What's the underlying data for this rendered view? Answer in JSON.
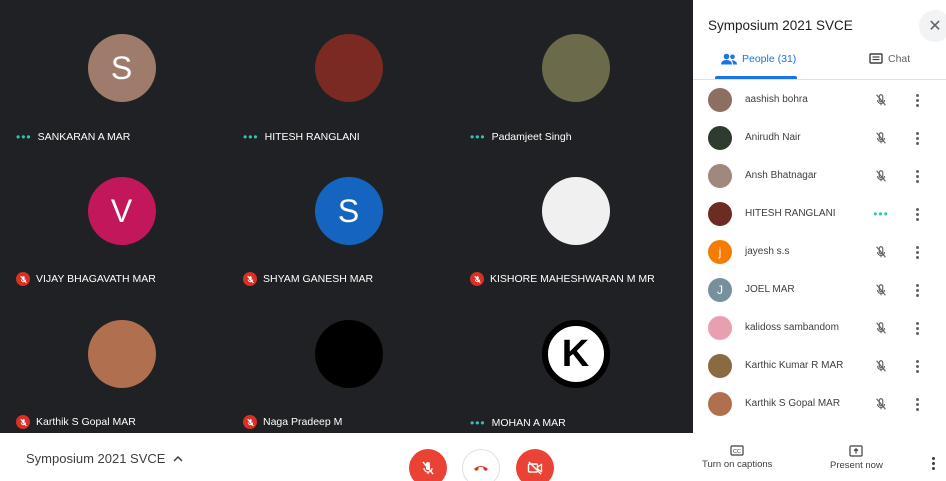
{
  "meeting": {
    "name": "Symposium 2021 SVCE"
  },
  "tiles": [
    {
      "name": "SANKARAN A MAR",
      "initial": "S",
      "avatar_color": "#9e7b6b",
      "status": "speaking"
    },
    {
      "name": "HITESH RANGLANI",
      "initial": "",
      "avatar_color": "#7a2a22",
      "status": "speaking"
    },
    {
      "name": "Padamjeet Singh",
      "initial": "",
      "avatar_color": "#6b6a4a",
      "status": "speaking"
    },
    {
      "name": "VIJAY BHAGAVATH MAR",
      "initial": "V",
      "avatar_color": "#c2185b",
      "status": "muted"
    },
    {
      "name": "SHYAM GANESH MAR",
      "initial": "S",
      "avatar_color": "#1565c0",
      "status": "muted"
    },
    {
      "name": "KISHORE MAHESHWARAN M MR",
      "initial": "",
      "avatar_color": "#f0f0f0",
      "status": "muted"
    },
    {
      "name": "Karthik S Gopal MAR",
      "initial": "",
      "avatar_color": "#b07050",
      "status": "muted"
    },
    {
      "name": "Naga Pradeep M",
      "initial": "",
      "avatar_color": "#000000",
      "status": "muted"
    },
    {
      "name": "MOHAN A MAR",
      "initial": "K",
      "avatar_color": "#000000",
      "status": "speaking"
    }
  ],
  "panel": {
    "title": "Symposium 2021 SVCE",
    "tab_people": "People (31)",
    "tab_chat": "Chat",
    "people": [
      {
        "name": "aashish bohra",
        "initial": "",
        "avatar_color": "#8d6e63",
        "status": "muted"
      },
      {
        "name": "Anirudh Nair",
        "initial": "",
        "avatar_color": "#2e3b2e",
        "status": "muted"
      },
      {
        "name": "Ansh Bhatnagar",
        "initial": "",
        "avatar_color": "#a1887f",
        "status": "muted"
      },
      {
        "name": "HITESH RANGLANI",
        "initial": "",
        "avatar_color": "#6d2c22",
        "status": "speaking"
      },
      {
        "name": "jayesh s.s",
        "initial": "j",
        "avatar_color": "#f57c00",
        "status": "muted"
      },
      {
        "name": "JOEL MAR",
        "initial": "J",
        "avatar_color": "#78909c",
        "status": "muted"
      },
      {
        "name": "kalidoss sambandom",
        "initial": "",
        "avatar_color": "#e8a0b0",
        "status": "muted"
      },
      {
        "name": "Karthic Kumar R MAR",
        "initial": "",
        "avatar_color": "#8a6a40",
        "status": "muted"
      },
      {
        "name": "Karthik S Gopal MAR",
        "initial": "",
        "avatar_color": "#b07050",
        "status": "muted"
      }
    ]
  },
  "bottom": {
    "captions_label": "Turn on captions",
    "present_label": "Present now"
  }
}
